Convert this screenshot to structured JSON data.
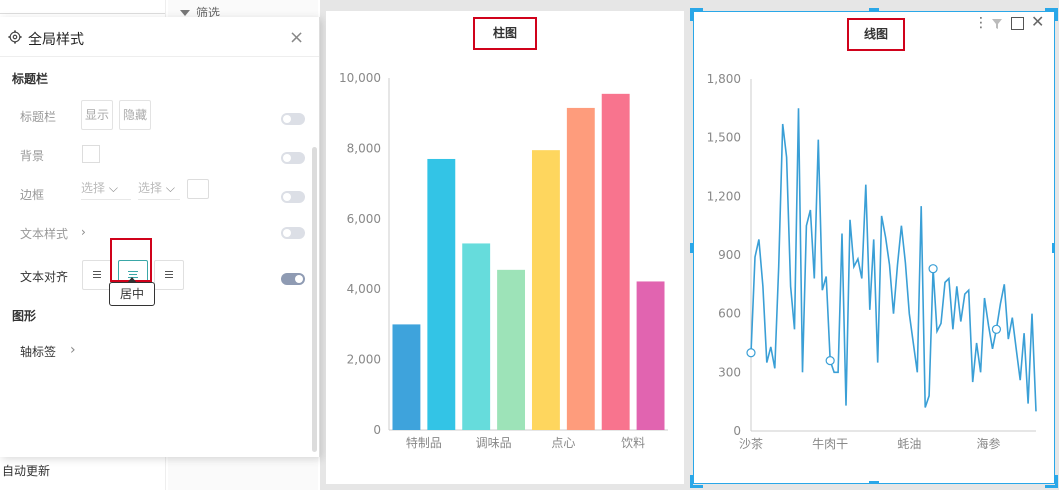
{
  "background": {
    "auto_update_label": "自动更新",
    "filter_label": "筛选"
  },
  "panel": {
    "title": "全局样式",
    "close_icon": "×",
    "section_title_bar": "标题栏",
    "rows": {
      "title_bar": {
        "label": "标题栏",
        "show": "显示",
        "hide": "隐藏"
      },
      "background": {
        "label": "背景"
      },
      "border": {
        "label": "边框",
        "select1": "选择",
        "select2": "选择"
      },
      "text_style": {
        "label": "文本样式"
      },
      "text_align": {
        "label": "文本对齐",
        "tooltip": "居中"
      }
    },
    "section_shape": "图形",
    "axis_label": "轴标签",
    "toggles": {
      "title_bar": false,
      "background": false,
      "border": false,
      "text_style": false,
      "text_align": true
    },
    "align_selected": "center"
  },
  "colors": {
    "accent": "#3aa7a7",
    "highlight": "#d0021b",
    "selection": "#2aa7e8",
    "line": "#3a9fd6"
  },
  "bar_chart": {
    "chart_data": {
      "type": "bar",
      "title": "柱图",
      "categories": [
        "特制品",
        "",
        "调味品",
        "",
        "点心",
        "",
        "饮料",
        ""
      ],
      "values": [
        3000,
        7700,
        5300,
        4550,
        7950,
        9150,
        9550,
        4220
      ],
      "colors": [
        "#3ea3dc",
        "#33c4e6",
        "#66dcdc",
        "#9de3b8",
        "#fed65e",
        "#fe9c7c",
        "#f8748e",
        "#e164b0"
      ],
      "ylim": [
        0,
        10000
      ],
      "yticks": [
        "0",
        "2,000",
        "4,000",
        "6,000",
        "8,000",
        "10,000"
      ],
      "ytick_values": [
        0,
        2000,
        4000,
        6000,
        8000,
        10000
      ],
      "xlabel": "",
      "ylabel": ""
    }
  },
  "line_chart": {
    "toolbar_icons": [
      "more-icon",
      "filter-icon",
      "maximize-icon",
      "close-icon"
    ],
    "chart_data": {
      "type": "line",
      "title": "线图",
      "x_tick_labels": [
        "沙茶",
        "牛肉干",
        "蚝油",
        "海参"
      ],
      "x_tick_index": [
        0,
        20,
        40,
        60
      ],
      "ylim": [
        0,
        1800
      ],
      "yticks": [
        "0",
        "300",
        "600",
        "900",
        "1,200",
        "1,500",
        "1,800"
      ],
      "ytick_values": [
        0,
        300,
        600,
        900,
        1200,
        1500,
        1800
      ],
      "values": [
        400,
        890,
        980,
        740,
        350,
        430,
        320,
        840,
        1570,
        1400,
        740,
        520,
        1650,
        300,
        1050,
        1130,
        780,
        1490,
        720,
        790,
        360,
        300,
        300,
        1010,
        130,
        1080,
        840,
        880,
        780,
        1260,
        620,
        980,
        350,
        1100,
        990,
        850,
        600,
        850,
        1050,
        860,
        600,
        450,
        300,
        1150,
        120,
        180,
        830,
        510,
        550,
        760,
        780,
        520,
        740,
        560,
        700,
        720,
        250,
        450,
        300,
        680,
        540,
        420,
        520,
        650,
        750,
        470,
        580,
        420,
        260,
        500,
        140,
        600,
        100
      ],
      "markers": [
        0,
        20,
        46,
        62
      ],
      "xlabel": "",
      "ylabel": ""
    }
  }
}
